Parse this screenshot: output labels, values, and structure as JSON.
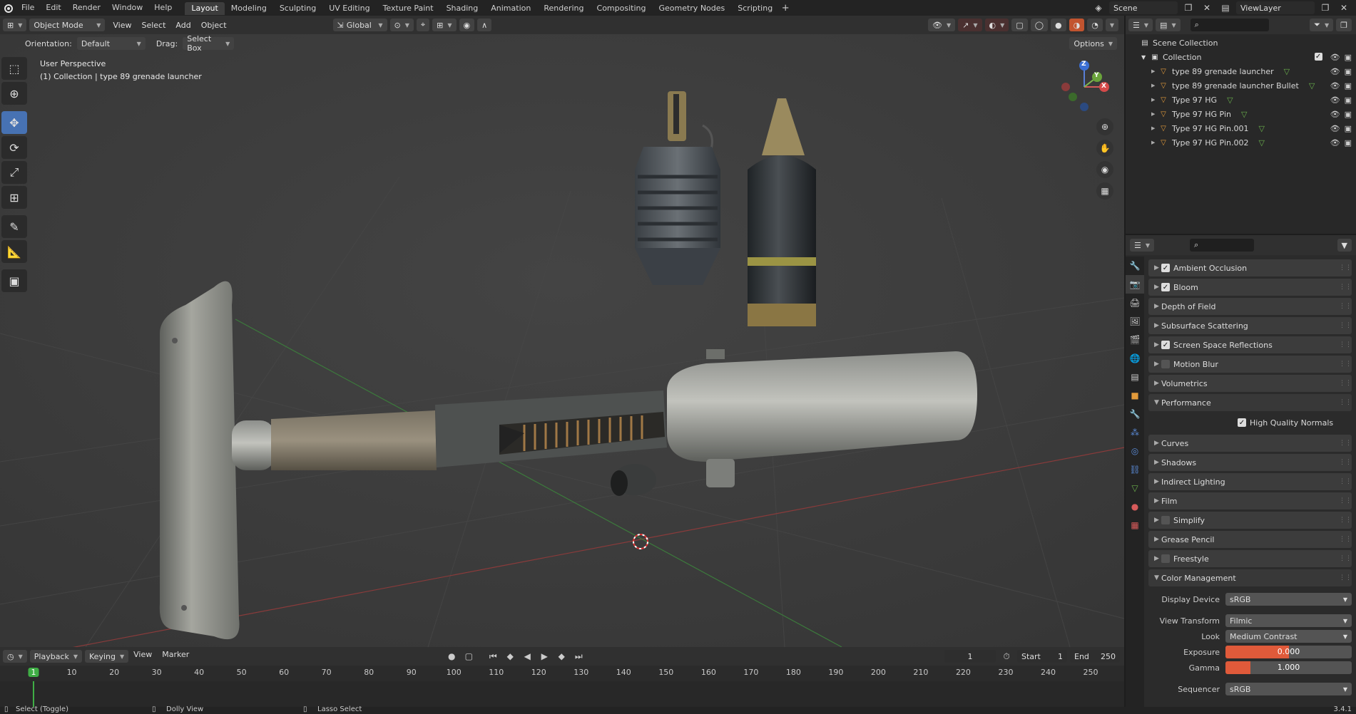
{
  "topbar": {
    "menus": [
      "File",
      "Edit",
      "Render",
      "Window",
      "Help"
    ],
    "workspaces": [
      "Layout",
      "Modeling",
      "Sculpting",
      "UV Editing",
      "Texture Paint",
      "Shading",
      "Animation",
      "Rendering",
      "Compositing",
      "Geometry Nodes",
      "Scripting"
    ],
    "active_workspace": "Layout",
    "scene": "Scene",
    "view_layer": "ViewLayer"
  },
  "viewport_header": {
    "mode": "Object Mode",
    "menus": [
      "View",
      "Select",
      "Add",
      "Object"
    ],
    "transform_orientation": "Global",
    "options_label": "Options"
  },
  "tool_settings": {
    "orientation_label": "Orientation:",
    "orientation_value": "Default",
    "drag_label": "Drag:",
    "drag_value": "Select Box"
  },
  "viewport": {
    "perspective_label": "User Perspective",
    "collection_label": "(1) Collection | type 89 grenade launcher",
    "gizmo_axes": {
      "z": "Z",
      "y": "Y",
      "x": "X"
    }
  },
  "outliner": {
    "scene_collection": "Scene Collection",
    "collection": "Collection",
    "items": [
      "type 89 grenade launcher",
      "type 89 grenade launcher Bullet",
      "Type 97 HG",
      "Type 97 HG Pin",
      "Type 97 HG Pin.001",
      "Type 97 HG Pin.002"
    ]
  },
  "properties": {
    "panels": [
      {
        "label": "Ambient Occlusion",
        "checkbox": true
      },
      {
        "label": "Bloom",
        "checkbox": true
      },
      {
        "label": "Depth of Field"
      },
      {
        "label": "Subsurface Scattering"
      },
      {
        "label": "Screen Space Reflections",
        "checkbox": true
      },
      {
        "label": "Motion Blur",
        "checkbox": false
      },
      {
        "label": "Volumetrics"
      },
      {
        "label": "Performance",
        "open": true
      }
    ],
    "performance_option": "High Quality Normals",
    "panels2": [
      {
        "label": "Curves"
      },
      {
        "label": "Shadows"
      },
      {
        "label": "Indirect Lighting"
      },
      {
        "label": "Film"
      },
      {
        "label": "Simplify",
        "checkbox": false
      },
      {
        "label": "Grease Pencil"
      },
      {
        "label": "Freestyle",
        "checkbox": false
      },
      {
        "label": "Color Management",
        "open": true
      }
    ],
    "color_management": {
      "display_device_label": "Display Device",
      "display_device": "sRGB",
      "view_transform_label": "View Transform",
      "view_transform": "Filmic",
      "look_label": "Look",
      "look": "Medium Contrast",
      "exposure_label": "Exposure",
      "exposure": "0.000",
      "gamma_label": "Gamma",
      "gamma": "1.000",
      "sequencer_label": "Sequencer",
      "sequencer": "sRGB"
    }
  },
  "timeline": {
    "menus": [
      "Playback",
      "Keying",
      "View",
      "Marker"
    ],
    "current_frame": "1",
    "start_label": "Start",
    "start": "1",
    "end_label": "End",
    "end": "250",
    "ruler": [
      "1",
      "10",
      "20",
      "30",
      "40",
      "50",
      "60",
      "70",
      "80",
      "90",
      "100",
      "110",
      "120",
      "130",
      "140",
      "150",
      "160",
      "170",
      "180",
      "190",
      "200",
      "210",
      "220",
      "230",
      "240",
      "250"
    ]
  },
  "statusbar": {
    "left": "Select (Toggle)",
    "middle": "Dolly View",
    "right": "Lasso Select",
    "version": "3.4.1"
  },
  "colors": {
    "accent_blue": "#4772b3",
    "exposure_orange": "#e05a3a",
    "frame_green": "#3fae45"
  }
}
